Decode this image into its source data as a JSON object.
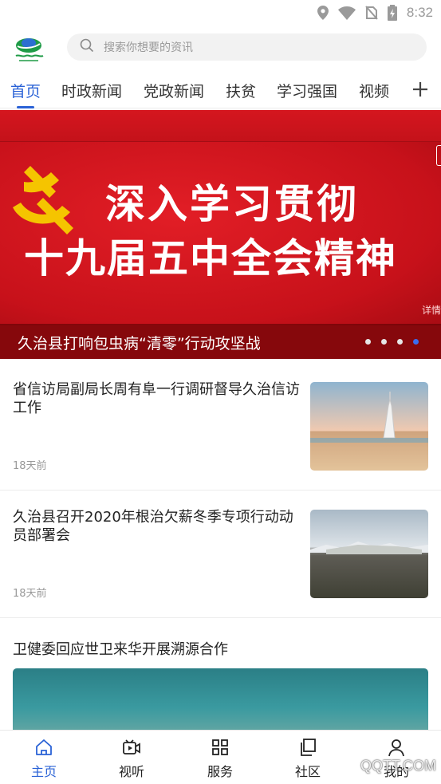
{
  "status_bar": {
    "time": "8:32",
    "icons": [
      "location-icon",
      "wifi-icon",
      "no-sim-icon",
      "battery-icon"
    ]
  },
  "header": {
    "logo": "app-logo",
    "search": {
      "placeholder": "搜索你想要的资讯",
      "value": ""
    }
  },
  "tabs": [
    {
      "label": "首页",
      "active": true
    },
    {
      "label": "时政新闻",
      "active": false
    },
    {
      "label": "党政新闻",
      "active": false
    },
    {
      "label": "扶贫",
      "active": false
    },
    {
      "label": "学习强国",
      "active": false
    },
    {
      "label": "视频",
      "active": false
    }
  ],
  "banner": {
    "headline_line1": "深入学习贯彻",
    "headline_line2": "十九届五中全会精神",
    "detail": "详情",
    "caption": "久治县打响包虫病“清零”行动攻坚战",
    "slide_count": 4,
    "active_slide": 4
  },
  "news": [
    {
      "title": "省信访局副局长周有阜一行调研督导久治信访工作",
      "time": "18天前",
      "thumbnail": "beach-tower-photo"
    },
    {
      "title": "久治县召开2020年根治欠薪冬季专项行动动员部署会",
      "time": "18天前",
      "thumbnail": "grassland-photo"
    },
    {
      "title": "卫健委回应世卫来华开展溯源合作",
      "thumbnail": "sea-photo"
    }
  ],
  "bottom_nav": [
    {
      "label": "主页",
      "icon": "home-icon",
      "active": true
    },
    {
      "label": "视听",
      "icon": "video-icon",
      "active": false
    },
    {
      "label": "服务",
      "icon": "grid-icon",
      "active": false
    },
    {
      "label": "社区",
      "icon": "copy-icon",
      "active": false
    },
    {
      "label": "我的",
      "icon": "user-icon",
      "active": false
    }
  ],
  "watermark": "QQTT.COM",
  "colors": {
    "accent": "#2a62d6",
    "banner_red": "#c8131b",
    "active_dot": "#3a6df0"
  }
}
